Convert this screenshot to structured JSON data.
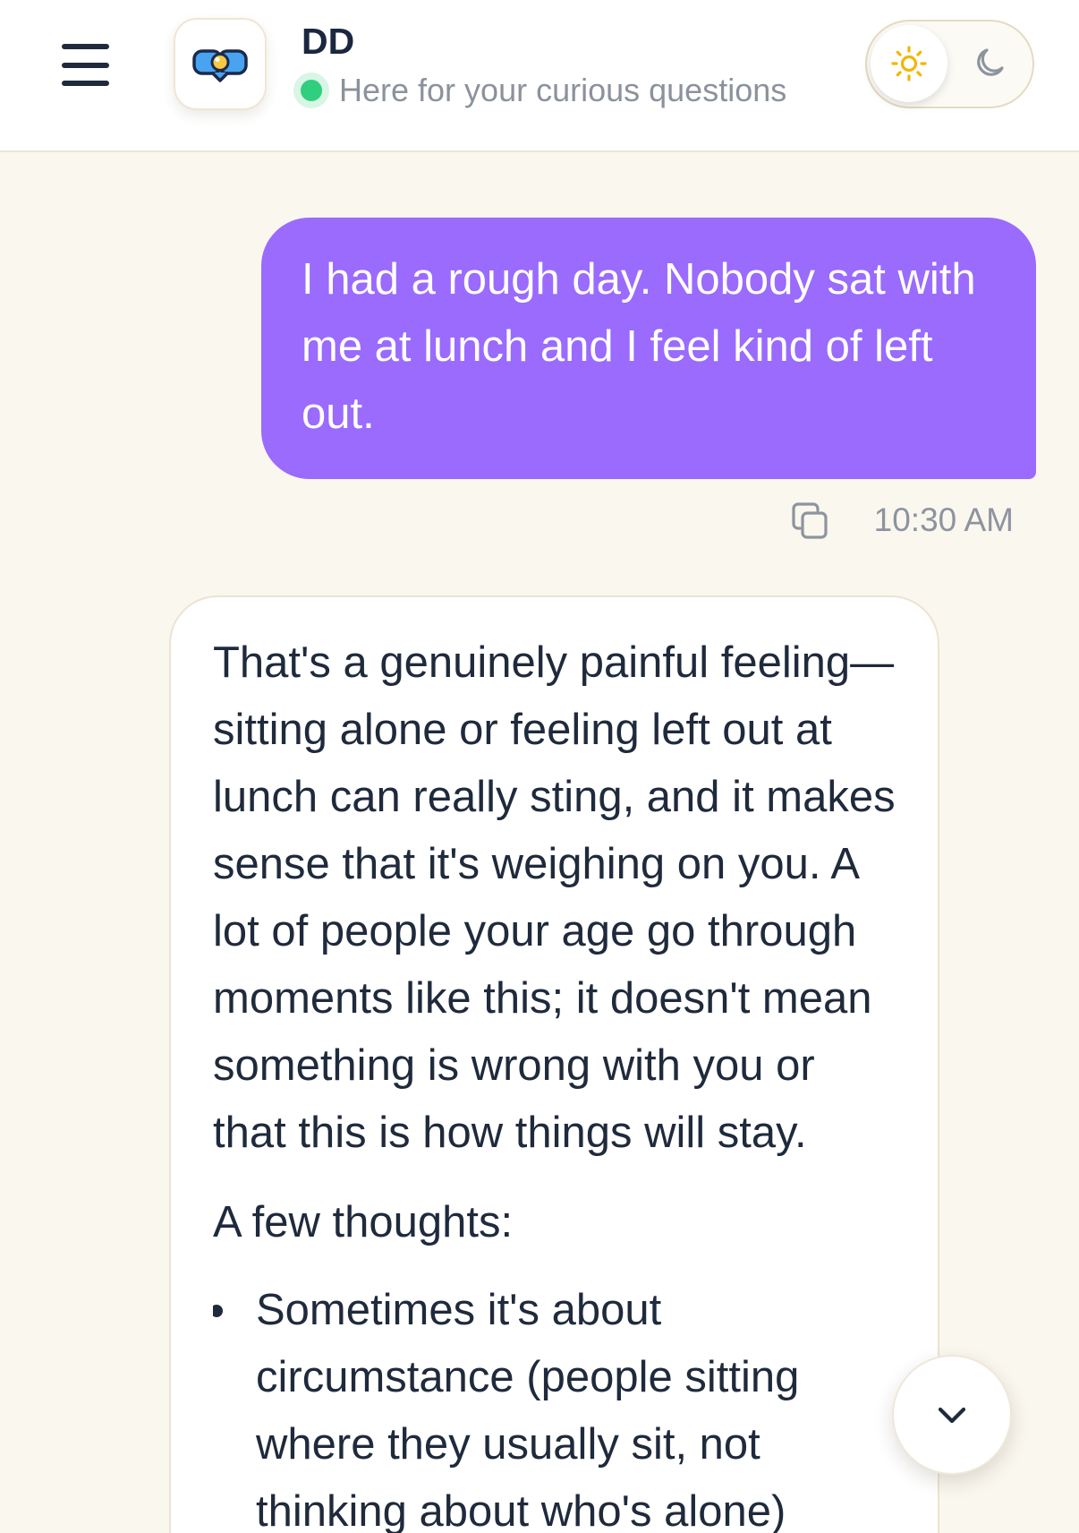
{
  "header": {
    "menu_icon": "hamburger-menu-icon",
    "logo_icon": "dd-logo-icon",
    "title": "DD",
    "status_icon": "online-dot-icon",
    "subtitle": "Here for your curious questions"
  },
  "theme_toggle": {
    "selected": "light",
    "options": [
      {
        "value": "light",
        "icon": "sun-icon"
      },
      {
        "value": "dark",
        "icon": "moon-icon"
      }
    ]
  },
  "conversation": {
    "messages": [
      {
        "role": "user",
        "text": "I had a rough day. Nobody sat with me at lunch and I feel kind of left out.",
        "time": "10:30 AM",
        "action_icon": "copy-icon"
      },
      {
        "role": "assistant",
        "paragraphs": [
          "That's a genuinely painful feeling—sitting alone or feeling left out at lunch can really sting, and it makes sense that it's weighing on you. A lot of people your age go through moments like this; it doesn't mean something is wrong with you or that this is how things will stay.",
          "A few thoughts:"
        ],
        "bullets": [
          "Sometimes it's about circumstance (people sitting where they usually sit, not thinking about who's alone)"
        ]
      }
    ]
  },
  "scroll_button": {
    "icon": "chevron-down-icon"
  },
  "colors": {
    "background": "#faf7ef",
    "header": "#ffffff",
    "user_bubble": "#9a6bfd",
    "status_online": "#2fcf7d",
    "sun": "#f2b600",
    "text": "#1f2a3c",
    "muted": "#8d949e"
  }
}
